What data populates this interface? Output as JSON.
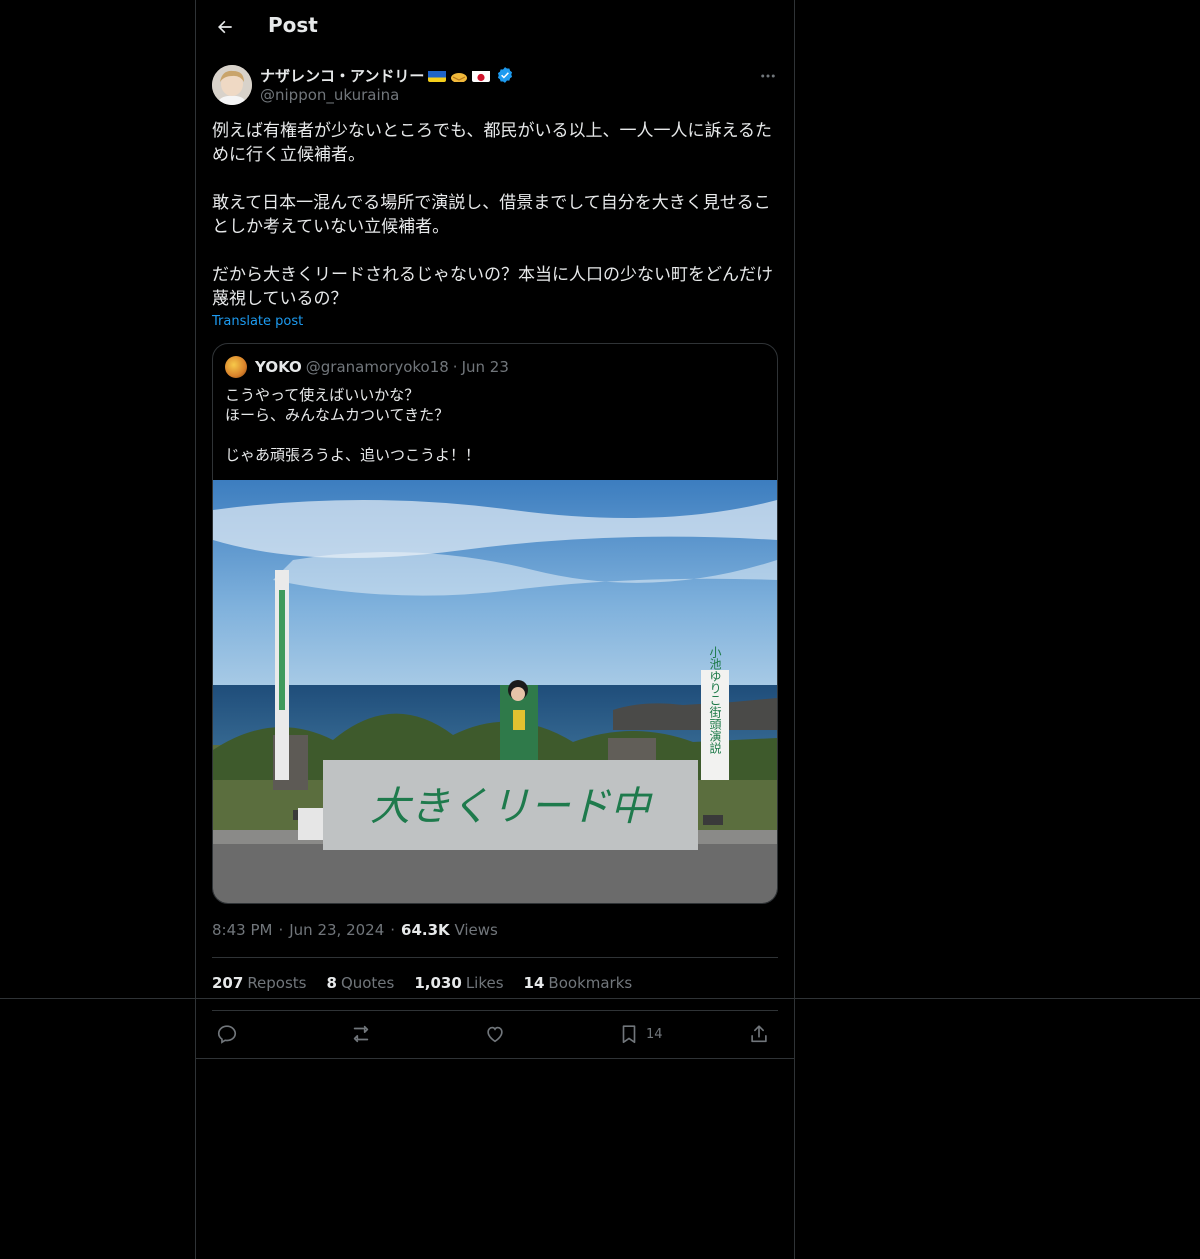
{
  "header": {
    "title": "Post"
  },
  "author": {
    "name": "ナザレンコ・アンドリー",
    "handle": "@nippon_ukuraina",
    "flags": [
      "ukraine-flag",
      "handshake",
      "japan-flag"
    ],
    "verified": true
  },
  "post": {
    "text": "例えば有権者が少ないところでも、都民がいる以上、一人一人に訴えるために行く立候補者。\n\n敢えて日本一混んでる場所で演説し、借景までして自分を大きく見せることしか考えていない立候補者。\n\nだから大きくリードされるじゃないの？本当に人口の少ない町をどんだけ蔑視しているの？",
    "translate_label": "Translate post"
  },
  "quote": {
    "name": "YOKO",
    "handle": "@granamoryoko18",
    "separator": "·",
    "date": "Jun 23",
    "text": "こうやって使えばいいかな？\nほーら、みんなムカついてきた？\n\nじゃあ頑張ろうよ、追いつこうよ！！",
    "image": {
      "banner_text": "大きくリード中",
      "sign_text": "小池ゆりこ街頭演説"
    }
  },
  "meta": {
    "time": "8:43 PM",
    "sep1": "·",
    "date": "Jun 23, 2024",
    "sep2": "·",
    "views_count": "64.3K",
    "views_label": "Views"
  },
  "stats": {
    "reposts_count": "207",
    "reposts_label": "Reposts",
    "quotes_count": "8",
    "quotes_label": "Quotes",
    "likes_count": "1,030",
    "likes_label": "Likes",
    "bookmarks_count": "14",
    "bookmarks_label": "Bookmarks"
  },
  "actions": {
    "reply_icon": "reply-icon",
    "repost_icon": "repost-icon",
    "like_icon": "heart-icon",
    "bookmark_icon": "bookmark-icon",
    "bookmark_count": "14",
    "share_icon": "share-icon"
  },
  "colors": {
    "background": "#000000",
    "text": "#e7e9ea",
    "secondary": "#71767b",
    "link": "#1d9bf0",
    "border": "#2f3336",
    "verified": "#1d9bf0"
  }
}
